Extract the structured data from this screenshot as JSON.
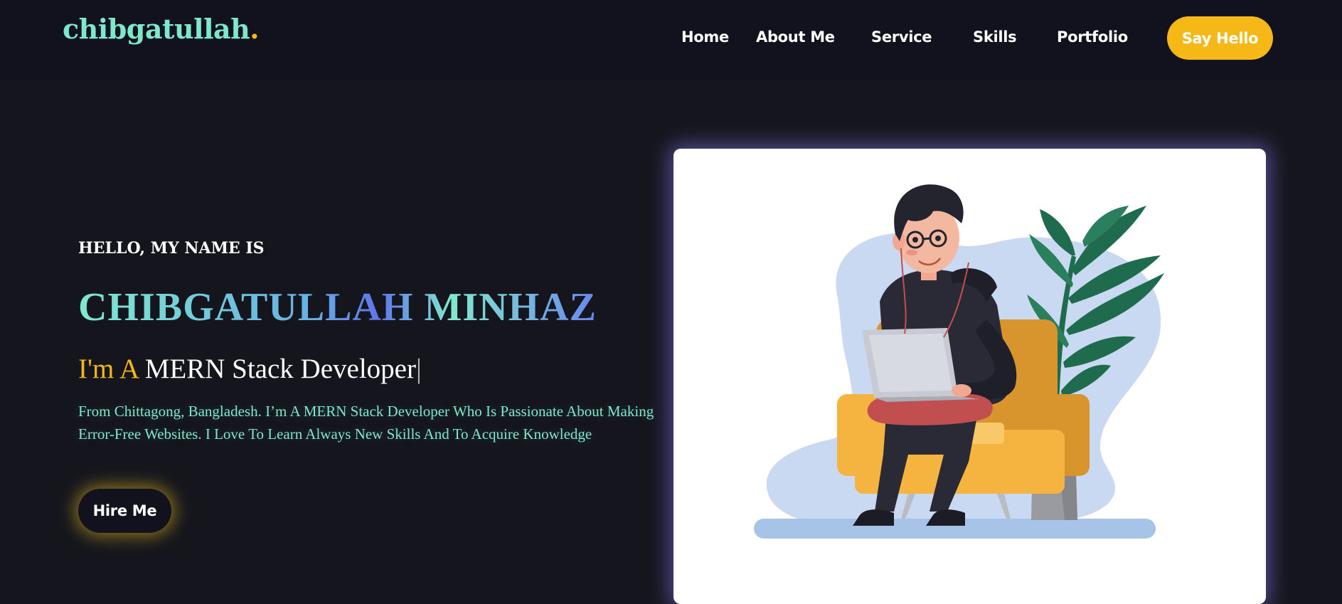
{
  "nav": {
    "logo": "chibgatullah",
    "logo_dot": ".",
    "links": [
      "Home",
      "About Me",
      "Service",
      "Skills",
      "Portfolio"
    ],
    "cta": "Say Hello"
  },
  "hero": {
    "greeting": "HELLO, MY NAME IS",
    "name": "CHIBGATULLAH MINHAZ",
    "role_prefix": "I'm A",
    "role_text": "MERN Stack Developer",
    "cursor": "|",
    "description": "From Chittagong, Bangladesh. I’m A MERN Stack Developer Who Is Passionate About Making Error-Free Websites. I Love To Learn Always New Skills And To Acquire Knowledge",
    "button": "Hire Me"
  },
  "colors": {
    "accent": "#f6b817",
    "teal": "#7ee8cb",
    "nav_bg": "#12121f",
    "page_bg": "#15161d"
  },
  "illustration": {
    "icon": "developer-with-laptop-illustration"
  }
}
